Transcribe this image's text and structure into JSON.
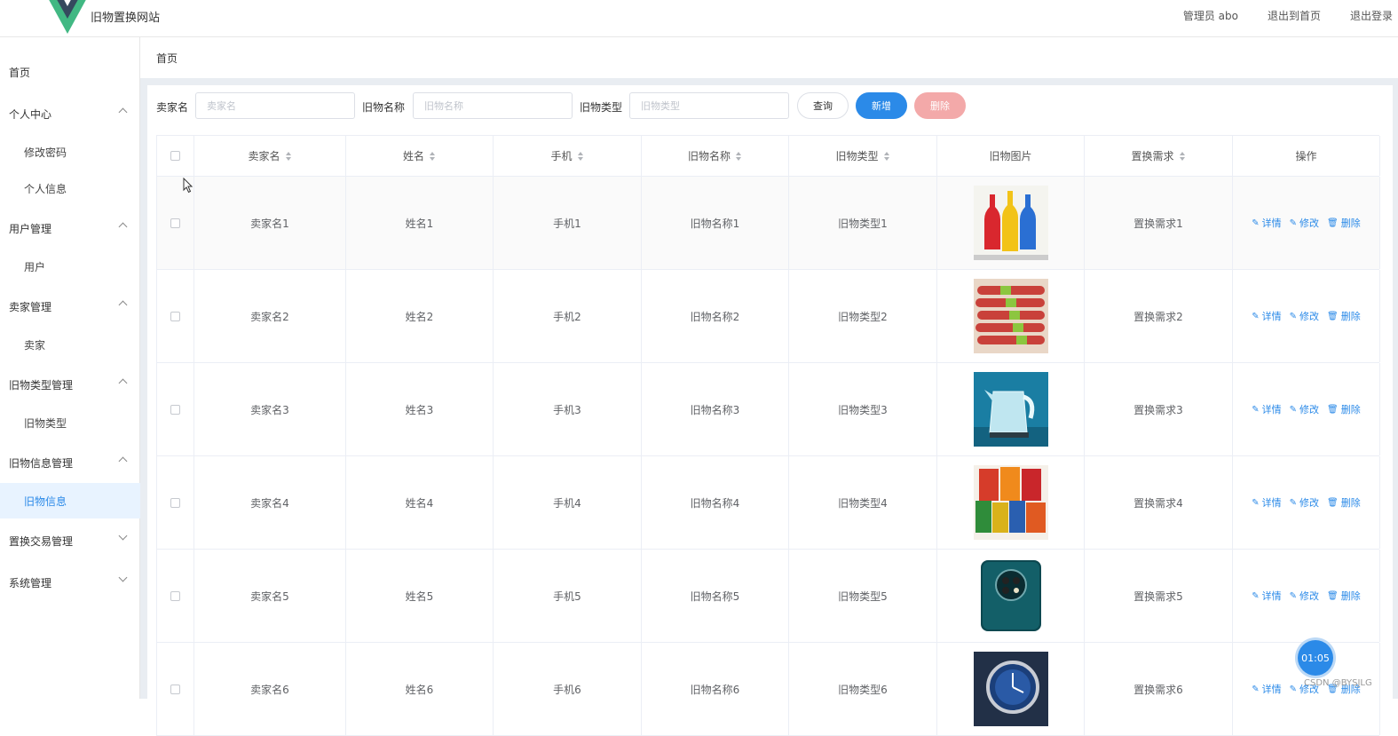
{
  "header": {
    "site_title": "旧物置换网站",
    "admin_label": "管理员 abo",
    "back_home": "退出到首页",
    "logout": "退出登录"
  },
  "sidebar": {
    "items": [
      {
        "label": "首页",
        "type": "top"
      },
      {
        "label": "个人中心",
        "type": "group",
        "expanded": true
      },
      {
        "label": "修改密码",
        "type": "sub"
      },
      {
        "label": "个人信息",
        "type": "sub"
      },
      {
        "label": "用户管理",
        "type": "group",
        "expanded": true
      },
      {
        "label": "用户",
        "type": "sub"
      },
      {
        "label": "卖家管理",
        "type": "group",
        "expanded": true
      },
      {
        "label": "卖家",
        "type": "sub"
      },
      {
        "label": "旧物类型管理",
        "type": "group",
        "expanded": true
      },
      {
        "label": "旧物类型",
        "type": "sub"
      },
      {
        "label": "旧物信息管理",
        "type": "group",
        "expanded": true
      },
      {
        "label": "旧物信息",
        "type": "sub",
        "active": true
      },
      {
        "label": "置换交易管理",
        "type": "group",
        "expanded": false
      },
      {
        "label": "系统管理",
        "type": "group",
        "expanded": false
      }
    ]
  },
  "breadcrumb": "首页",
  "search": {
    "seller_label": "卖家名",
    "seller_placeholder": "卖家名",
    "item_name_label": "旧物名称",
    "item_name_placeholder": "旧物名称",
    "item_type_label": "旧物类型",
    "item_type_placeholder": "旧物类型",
    "query_btn": "查询",
    "add_btn": "新增",
    "delete_btn": "删除"
  },
  "table": {
    "columns": [
      "卖家名",
      "姓名",
      "手机",
      "旧物名称",
      "旧物类型",
      "旧物图片",
      "置换需求",
      "操作"
    ],
    "rows": [
      {
        "seller": "卖家名1",
        "name": "姓名1",
        "phone": "手机1",
        "item": "旧物名称1",
        "type": "旧物类型1",
        "image": "bottles",
        "demand": "置换需求1"
      },
      {
        "seller": "卖家名2",
        "name": "姓名2",
        "phone": "手机2",
        "item": "旧物名称2",
        "type": "旧物类型2",
        "image": "sausages",
        "demand": "置换需求2"
      },
      {
        "seller": "卖家名3",
        "name": "姓名3",
        "phone": "手机3",
        "item": "旧物名称3",
        "type": "旧物类型3",
        "image": "kettle",
        "demand": "置换需求3"
      },
      {
        "seller": "卖家名4",
        "name": "姓名4",
        "phone": "手机4",
        "item": "旧物名称4",
        "type": "旧物类型4",
        "image": "snacks",
        "demand": "置换需求4"
      },
      {
        "seller": "卖家名5",
        "name": "姓名5",
        "phone": "手机5",
        "item": "旧物名称5",
        "type": "旧物类型5",
        "image": "phone",
        "demand": "置换需求5"
      },
      {
        "seller": "卖家名6",
        "name": "姓名6",
        "phone": "手机6",
        "item": "旧物名称6",
        "type": "旧物类型6",
        "image": "watch",
        "demand": "置换需求6"
      }
    ],
    "ops": {
      "detail": "详情",
      "edit": "修改",
      "delete": "删除"
    }
  },
  "fab_time": "01:05",
  "watermark": "CSDN @BYSJLG",
  "colors": {
    "primary": "#2b8ae8",
    "danger_light": "#f3a9a9",
    "active_bg": "#e8f3ff"
  }
}
